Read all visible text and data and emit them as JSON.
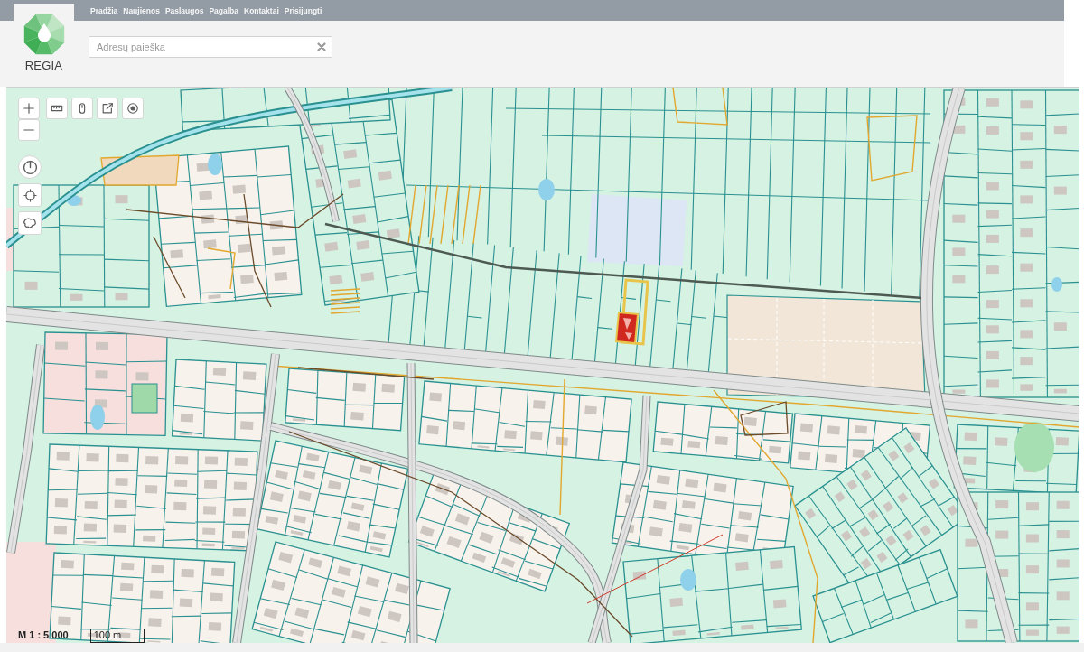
{
  "header": {
    "logo_text": "REGIA",
    "nav_links": [
      "Pradžia",
      "Naujienos",
      "Paslaugos",
      "Pagalba",
      "Kontaktai",
      "Prisijungti"
    ]
  },
  "search": {
    "placeholder": "Adresų paieška"
  },
  "map": {
    "scale_ratio": "M 1 : 5 000",
    "scale_bar": "100 m"
  }
}
